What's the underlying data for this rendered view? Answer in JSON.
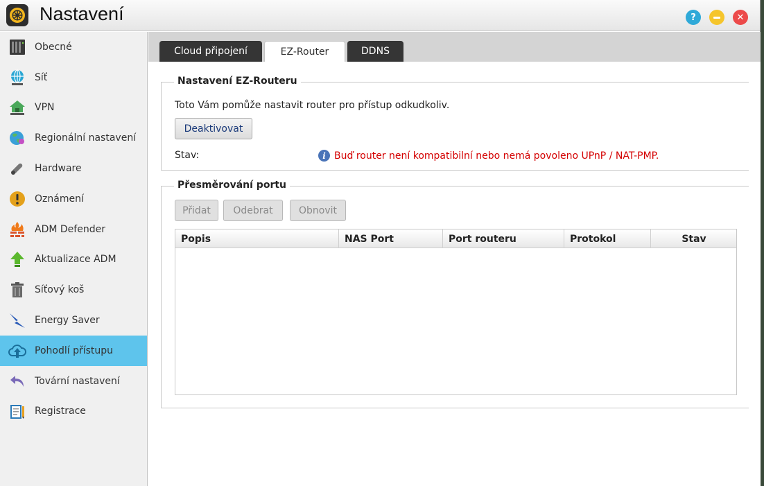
{
  "window": {
    "title": "Nastavení"
  },
  "sidebar": {
    "items": [
      {
        "label": "Obecné",
        "icon": "nas-device-icon"
      },
      {
        "label": "Síť",
        "icon": "network-globe-icon"
      },
      {
        "label": "VPN",
        "icon": "vpn-house-icon"
      },
      {
        "label": "Regionální nastavení",
        "icon": "globe-pin-icon"
      },
      {
        "label": "Hardware",
        "icon": "wrench-icon"
      },
      {
        "label": "Oznámení",
        "icon": "exclamation-icon"
      },
      {
        "label": "ADM Defender",
        "icon": "firewall-icon"
      },
      {
        "label": "Aktualizace ADM",
        "icon": "up-arrow-icon"
      },
      {
        "label": "Síťový koš",
        "icon": "trash-icon"
      },
      {
        "label": "Energy Saver",
        "icon": "lightning-icon"
      },
      {
        "label": "Pohodlí přístupu",
        "icon": "cloud-upload-icon"
      },
      {
        "label": "Tovární nastavení",
        "icon": "undo-arrow-icon"
      },
      {
        "label": "Registrace",
        "icon": "clipboard-pen-icon"
      }
    ],
    "active_index": 10
  },
  "tabs": [
    {
      "label": "Cloud připojení"
    },
    {
      "label": "EZ-Router"
    },
    {
      "label": "DDNS"
    }
  ],
  "ez_router": {
    "title": "Nastavení EZ-Routeru",
    "description": "Toto Vám pomůže nastavit router pro přístup odkudkoliv.",
    "deactivate_label": "Deaktivovat",
    "status_label": "Stav:",
    "status_message": "Buď router není kompatibilní nebo nemá povoleno UPnP / NAT-PMP.",
    "status_color": "#d40000"
  },
  "port_forwarding": {
    "title": "Přesměrování portu",
    "buttons": {
      "add": "Přidat",
      "remove": "Odebrat",
      "refresh": "Obnovit"
    },
    "columns": [
      "Popis",
      "NAS Port",
      "Port routeru",
      "Protokol",
      "Stav"
    ],
    "rows": []
  },
  "colors": {
    "active_item": "#5ec4ec",
    "tab_dark": "#353535"
  }
}
